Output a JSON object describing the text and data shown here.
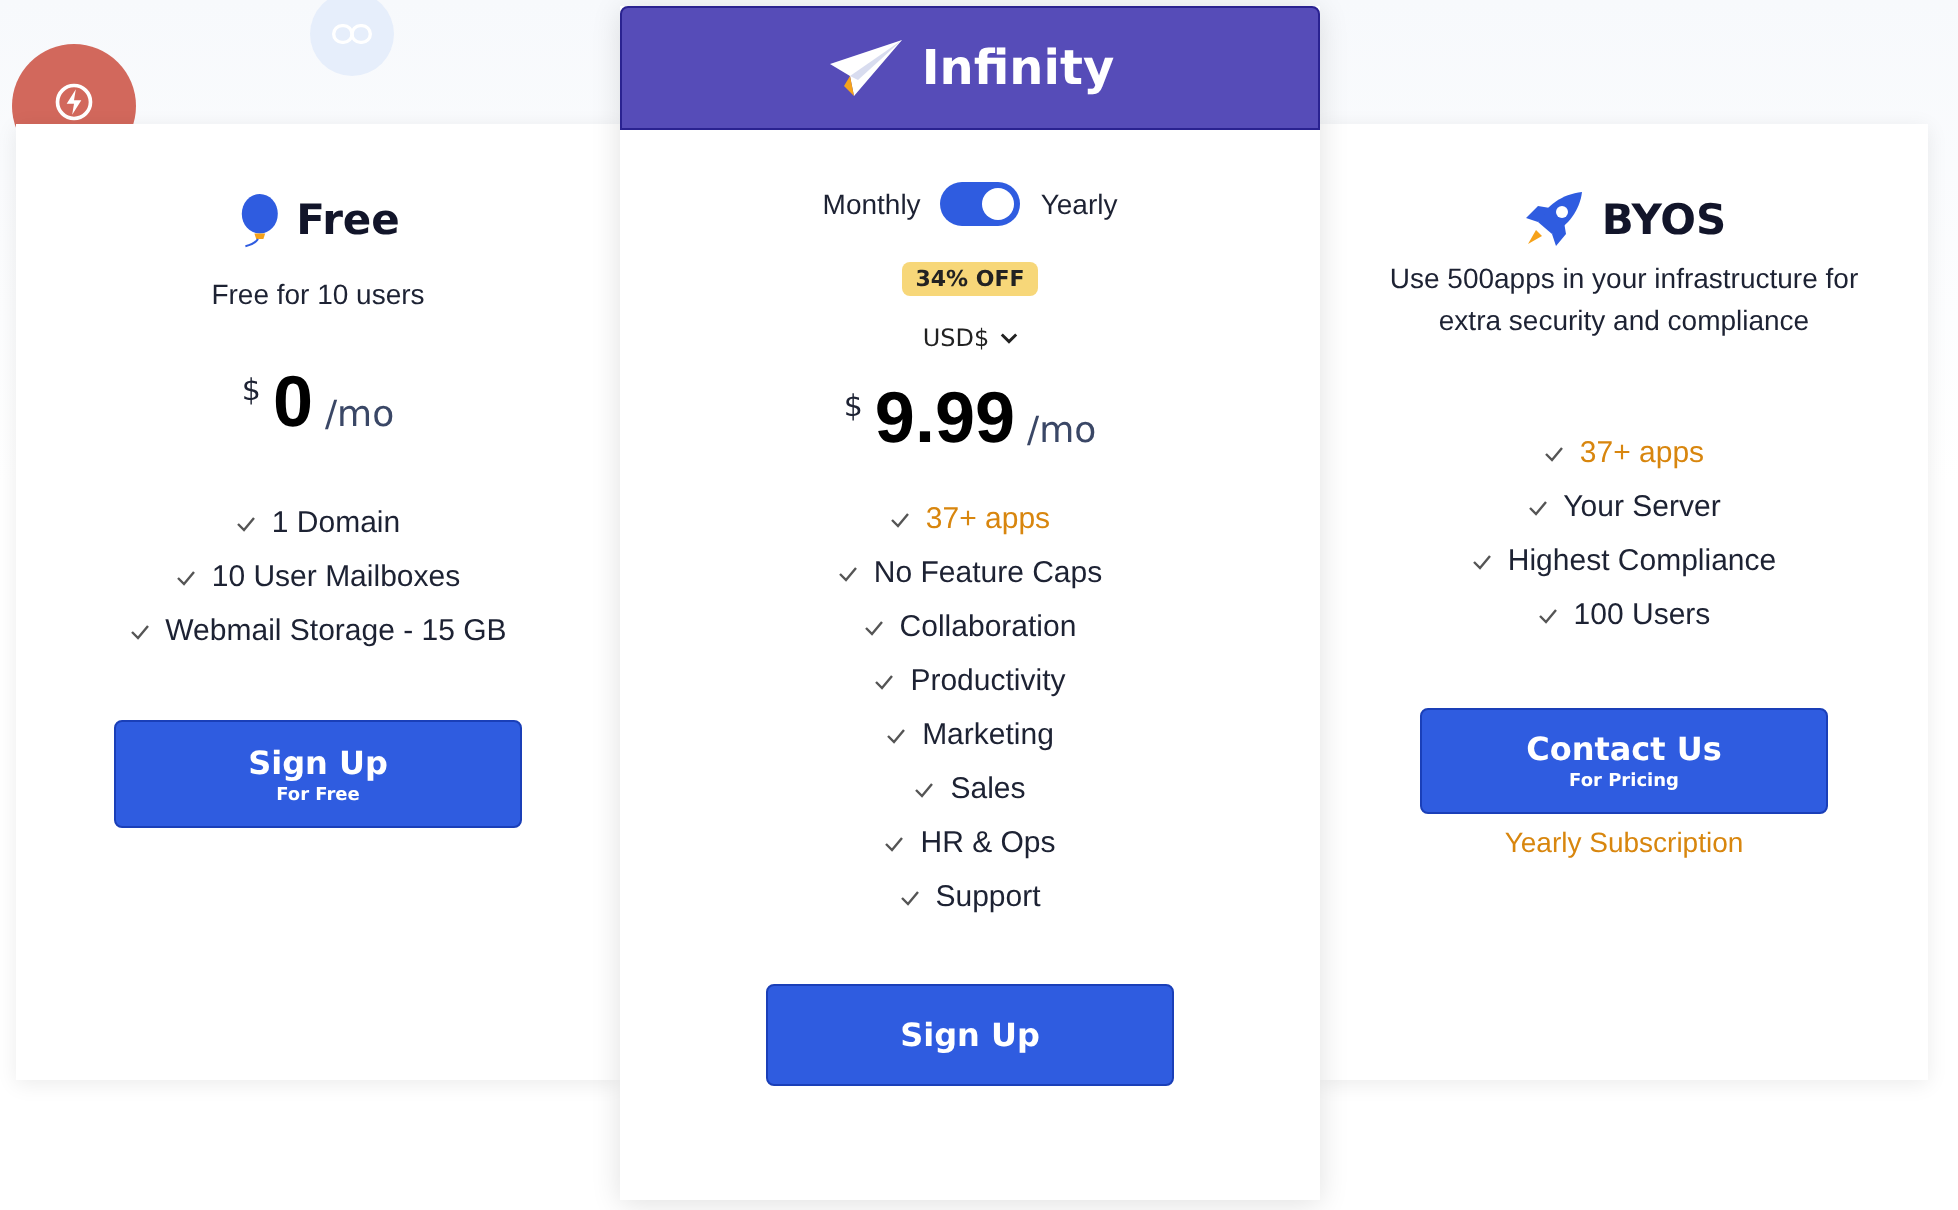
{
  "plans": [
    {
      "kind": "free",
      "title": "Free",
      "subtitle": "Free for 10 users",
      "currency_symbol": "$",
      "price": "0",
      "period": "/mo",
      "features": [
        {
          "text": "1 Domain",
          "highlight": false
        },
        {
          "text": "10 User Mailboxes",
          "highlight": false
        },
        {
          "text": "Webmail Storage - 15 GB",
          "highlight": false
        }
      ],
      "button": {
        "label": "Sign Up",
        "sublabel": "For Free"
      }
    },
    {
      "kind": "featured",
      "title": "Infinity",
      "billing": {
        "left": "Monthly",
        "right": "Yearly",
        "on": true
      },
      "badge": "34% OFF",
      "currency": "USD$",
      "currency_symbol": "$",
      "price": "9.99",
      "period": "/mo",
      "features": [
        {
          "text": "37+ apps",
          "highlight": true
        },
        {
          "text": "No Feature Caps",
          "highlight": false
        },
        {
          "text": "Collaboration",
          "highlight": false
        },
        {
          "text": "Productivity",
          "highlight": false
        },
        {
          "text": "Marketing",
          "highlight": false
        },
        {
          "text": "Sales",
          "highlight": false
        },
        {
          "text": "HR & Ops",
          "highlight": false
        },
        {
          "text": "Support",
          "highlight": false
        }
      ],
      "button": {
        "label": "Sign Up"
      }
    },
    {
      "kind": "byos",
      "title": "BYOS",
      "subtitle": "Use 500apps in your infrastructure for extra security and compliance",
      "features": [
        {
          "text": "37+ apps",
          "highlight": true
        },
        {
          "text": "Your Server",
          "highlight": false
        },
        {
          "text": "Highest Compliance",
          "highlight": false
        },
        {
          "text": "100 Users",
          "highlight": false
        }
      ],
      "button": {
        "label": "Contact Us",
        "sublabel": "For Pricing"
      },
      "note": "Yearly Subscription"
    }
  ]
}
